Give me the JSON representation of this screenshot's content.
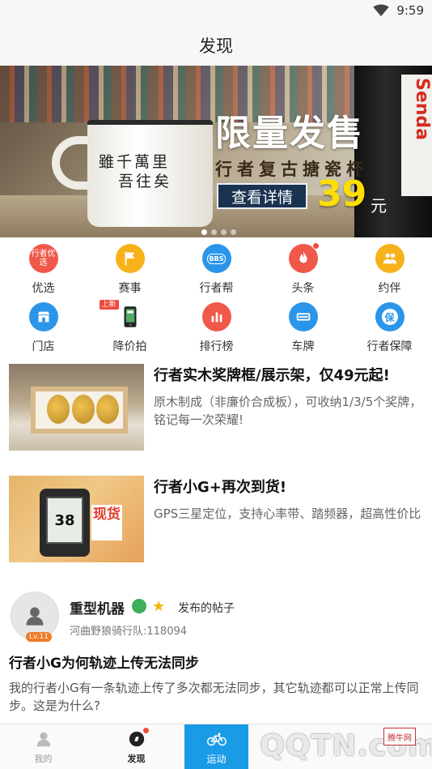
{
  "status_bar": {
    "time": "9:59"
  },
  "header": {
    "title": "发现"
  },
  "banner": {
    "mug_text_line1": "雖千萬里",
    "mug_text_line2": "吾往矣",
    "headline": "限量发售",
    "subtitle": "行者复古搪瓷杯",
    "cta": "查看详情",
    "price": "39",
    "price_unit": "元",
    "bottle_text": "Senda",
    "slide_count": 4,
    "active_slide": 1
  },
  "quick_grid": [
    {
      "label": "优选",
      "icon": "xingzhe-pick-icon",
      "badge_text": "行者优选",
      "color": "#f0584a"
    },
    {
      "label": "赛事",
      "icon": "flag-icon",
      "color": "#f7b21b"
    },
    {
      "label": "行者帮",
      "icon": "bbs-icon",
      "badge_text": "BBS",
      "color": "#2b95e9"
    },
    {
      "label": "头条",
      "icon": "fire-icon",
      "color": "#f0584a",
      "has_dot": true
    },
    {
      "label": "约伴",
      "icon": "people-icon",
      "color": "#f7b21b"
    },
    {
      "label": "门店",
      "icon": "store-icon",
      "color": "#2b95e9"
    },
    {
      "label": "降价拍",
      "icon": "phone-auction-icon",
      "color": "#333333",
      "tag": "上新"
    },
    {
      "label": "排行榜",
      "icon": "bar-chart-icon",
      "color": "#f0584a"
    },
    {
      "label": "车牌",
      "icon": "license-plate-icon",
      "color": "#2b95e9"
    },
    {
      "label": "行者保障",
      "icon": "shield-icon",
      "badge_text": "保",
      "color": "#2b95e9"
    }
  ],
  "articles": [
    {
      "title": "行者实木奖牌框/展示架，仅49元起!",
      "desc": "原木制成（非廉价合成板），可收纳1/3/5个奖牌，铭记每一次荣耀!"
    },
    {
      "title": "行者小G+再次到货!",
      "desc": "GPS三星定位，支持心率带、踏频器，超高性价比",
      "thumb_screen": "38",
      "thumb_badge": "现货"
    }
  ],
  "post": {
    "level": "Lv.11",
    "username": "重型机器",
    "action": "发布的帖子",
    "team": "河曲野狼骑行队:118094",
    "title": "行者小G为何轨迹上传无法同步",
    "body": "我的行者小G有一条轨迹上传了多次都无法同步，其它轨迹都可以正常上传同步。这是为什么?"
  },
  "tabbar": [
    {
      "label": "我的",
      "icon": "person-icon"
    },
    {
      "label": "发现",
      "icon": "compass-icon",
      "active": true,
      "has_dot": true
    },
    {
      "label": "运动",
      "icon": "bike-icon"
    },
    {
      "label": "",
      "icon": "watermark-area"
    },
    {
      "label": "",
      "icon": "watermark-area"
    }
  ],
  "watermark": {
    "text": "QQTN.com",
    "logo_text": "腾牛网"
  },
  "colors": {
    "accent_blue": "#1a9be6",
    "red": "#f0584a",
    "yellow": "#f7b21b"
  }
}
